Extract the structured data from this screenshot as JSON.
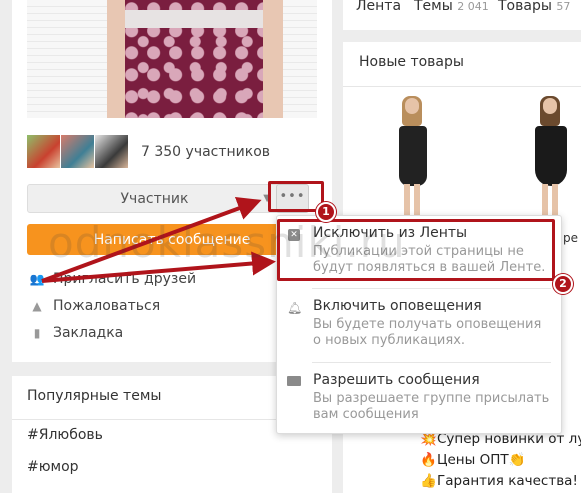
{
  "group": {
    "members_count": "7 350 участников",
    "member_button_label": "Участник",
    "more_button_label": "•••",
    "write_button_label": "Написать сообщение"
  },
  "actions": [
    {
      "icon": "people-icon",
      "label": "Пригласить друзей"
    },
    {
      "icon": "warning-icon",
      "label": "Пожаловаться"
    },
    {
      "icon": "bookmark-icon",
      "label": "Закладка"
    }
  ],
  "popular": {
    "title": "Популярные темы",
    "tags": [
      "#Ялюбовь",
      "#юмор"
    ]
  },
  "tabs": [
    {
      "label": "Лента",
      "count": ""
    },
    {
      "label": "Темы",
      "count": "2 041"
    },
    {
      "label": "Товары",
      "count": "57"
    }
  ],
  "goods": {
    "title": "Новые товары",
    "partial_label": "ре"
  },
  "dropdown": {
    "items": [
      {
        "icon": "close-square-icon",
        "title": "Исключить из Ленты",
        "desc": "Публикации этой страницы не будут появляться в вашей Ленте."
      },
      {
        "icon": "bell-icon",
        "title": "Включить оповещения",
        "desc": "Вы будете получать оповещения о новых публикациях."
      },
      {
        "icon": "mail-icon",
        "title": "Разрешить сообщения",
        "desc": "Вы разрешаете группе присылать вам сообщения"
      }
    ]
  },
  "feed_lines": [
    {
      "emoji": "💥",
      "text": "Супер новинки от луч"
    },
    {
      "emoji": "🔥",
      "text": "Цены ОПТ👏"
    },
    {
      "emoji": "👍",
      "text": "Гарантия качества! пр"
    }
  ],
  "annotations": {
    "badge_1": "1",
    "badge_2": "2",
    "highlight_color": "#b0141b"
  },
  "watermark": "odnoklassniki.ru",
  "colors": {
    "accent": "#f7931e",
    "annotation": "#b0141b"
  }
}
